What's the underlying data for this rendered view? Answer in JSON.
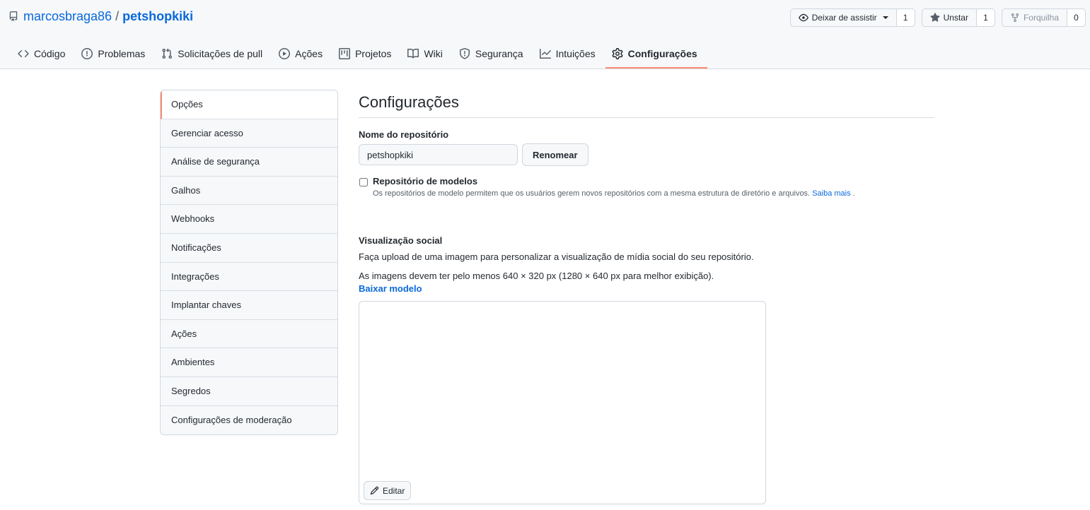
{
  "repo": {
    "owner": "marcosbraga86",
    "separator": "/",
    "name": "petshopkiki"
  },
  "actions": {
    "watch_label": "Deixar de assistir",
    "watch_count": "1",
    "star_label": "Unstar",
    "star_count": "1",
    "fork_label": "Forquilha",
    "fork_count": "0"
  },
  "nav": {
    "tabs": [
      {
        "label": "Código",
        "icon": "code-icon"
      },
      {
        "label": "Problemas",
        "icon": "issue-icon"
      },
      {
        "label": "Solicitações de pull",
        "icon": "pull-request-icon"
      },
      {
        "label": "Ações",
        "icon": "play-icon"
      },
      {
        "label": "Projetos",
        "icon": "project-icon"
      },
      {
        "label": "Wiki",
        "icon": "book-icon"
      },
      {
        "label": "Segurança",
        "icon": "shield-icon"
      },
      {
        "label": "Intuições",
        "icon": "graph-icon"
      },
      {
        "label": "Configurações",
        "icon": "gear-icon",
        "selected": true
      }
    ]
  },
  "sidebar": {
    "items": [
      {
        "label": "Opções",
        "selected": true
      },
      {
        "label": "Gerenciar acesso"
      },
      {
        "label": "Análise de segurança"
      },
      {
        "label": "Galhos"
      },
      {
        "label": "Webhooks"
      },
      {
        "label": "Notificações"
      },
      {
        "label": "Integrações"
      },
      {
        "label": "Implantar chaves"
      },
      {
        "label": "Ações"
      },
      {
        "label": "Ambientes"
      },
      {
        "label": "Segredos"
      },
      {
        "label": "Configurações de moderação"
      }
    ]
  },
  "main": {
    "heading": "Configurações",
    "repo_name_label": "Nome do repositório",
    "repo_name_value": "petshopkiki",
    "rename_button": "Renomear",
    "template_label": "Repositório de modelos",
    "template_checked": false,
    "template_note": "Os repositórios de modelo permitem que os usuários gerem novos repositórios com a mesma estrutura de diretório e arquivos.",
    "template_link": "Saiba mais",
    "template_note_end": ".",
    "social_heading": "Visualização social",
    "social_desc": "Faça upload de uma imagem para personalizar a visualização de mídia social do seu repositório.",
    "social_requirements": "As imagens devem ter pelo menos 640 × 320 px (1280 × 640 px para melhor exibição).",
    "download_link": "Baixar modelo",
    "edit_button": "Editar"
  },
  "colors": {
    "link": "#0969da",
    "selected_accent": "#fd8c73",
    "header_bg": "#f6f8fa",
    "border": "#d0d7de"
  }
}
